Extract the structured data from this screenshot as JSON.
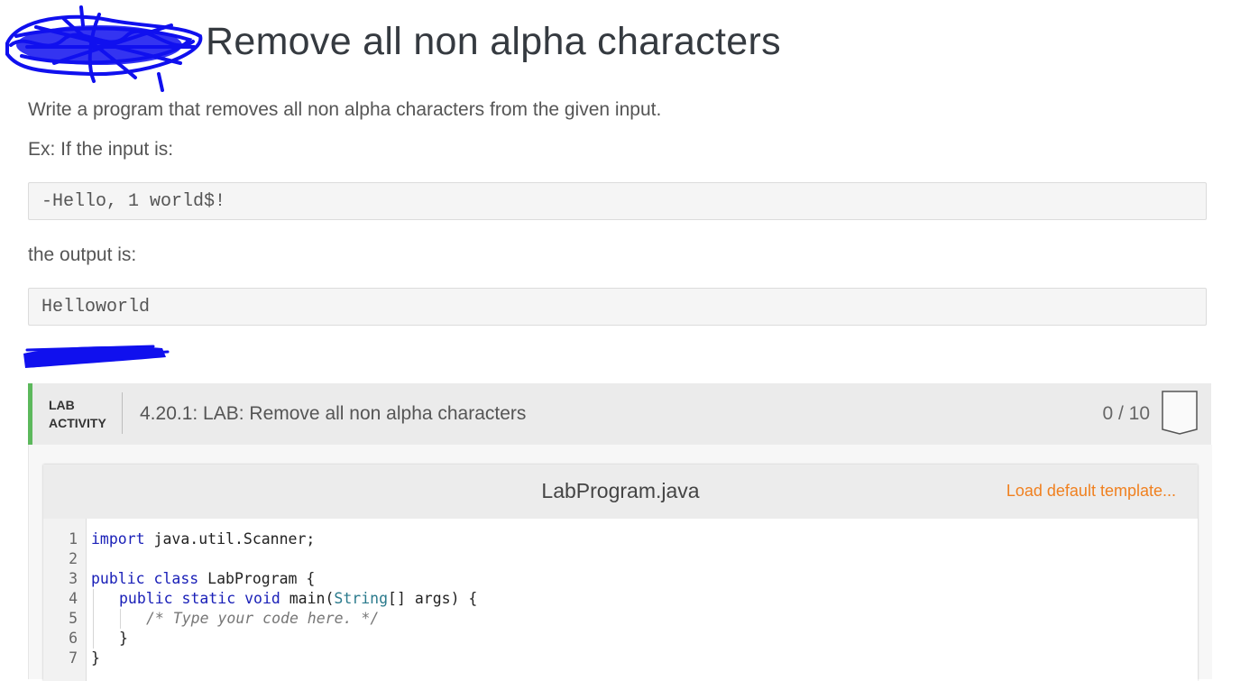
{
  "page": {
    "title": "Remove all non alpha characters",
    "description": "Write a program that removes all non alpha characters from the given input.",
    "example_intro": "Ex: If the input is:",
    "example_input": "-Hello, 1 world$!",
    "output_intro": "the output is:",
    "example_output": "Helloworld"
  },
  "lab": {
    "tag_line1": "LAB",
    "tag_line2": "ACTIVITY",
    "title": "4.20.1: LAB: Remove all non alpha characters",
    "score": "0 / 10",
    "badge_icon": "shield-badge-icon"
  },
  "editor": {
    "filename": "LabProgram.java",
    "load_template": "Load default template...",
    "line_numbers": [
      "1",
      "2",
      "3",
      "4",
      "5",
      "6",
      "7"
    ],
    "lines": {
      "l1_kw": "import",
      "l1_rest": " java.util.Scanner;",
      "l3_kw": "public class",
      "l3_rest": " LabProgram {",
      "l4_kw": "public static void",
      "l4_mid": " main(",
      "l4_type": "String",
      "l4_rest": "[] args) {",
      "l5_comment": "/* Type your code here. */",
      "l6": "}",
      "l7": "}"
    }
  },
  "colors": {
    "accent_green": "#5cb85c",
    "link_orange": "#f0801f",
    "scribble_blue": "#1010ee"
  }
}
